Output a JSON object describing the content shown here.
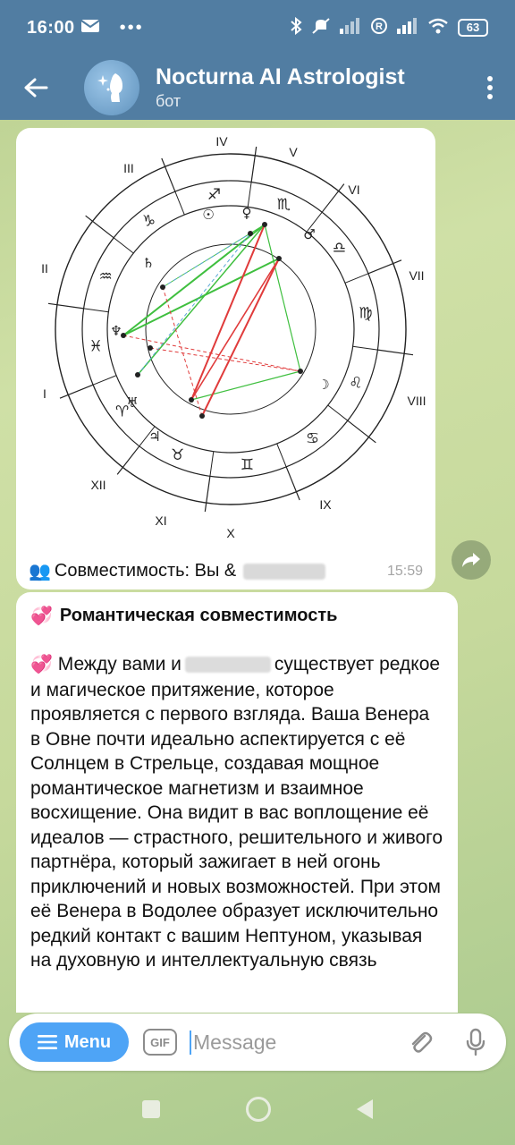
{
  "status_bar": {
    "time": "16:00",
    "battery": "63",
    "icons": [
      "mail-icon",
      "more-icon",
      "bluetooth-icon",
      "mute-icon",
      "signal-icon",
      "registered-icon",
      "signal-icon",
      "wifi-icon",
      "battery-icon"
    ]
  },
  "header": {
    "title": "Nocturna AI Astrologist",
    "subtitle": "бот"
  },
  "chart_message": {
    "house_numerals": [
      "I",
      "II",
      "III",
      "IV",
      "V",
      "VI",
      "VII",
      "VIII",
      "IX",
      "X",
      "XI",
      "XII"
    ],
    "caption_prefix": "👥",
    "caption": "Совместимость: Вы &",
    "timestamp": "15:59"
  },
  "text_message": {
    "heading_emoji": "💞",
    "heading": "Романтическая совместимость",
    "para_emoji": "💞",
    "para_start": "Между вами и",
    "para_rest": "существует редкое и магическое притяжение, которое проявляется с первого взгляда. Ваша Венера в Овне почти идеально аспектируется с её Солнцем в Стрельце, создавая мощное романтическое магнетизм и взаимное восхищение. Она видит в вас воплощение её идеалов — страстного, решительного и живого партнёра, который зажигает в ней огонь приключений и новых возможностей. При этом её Венера в Водолее образует исключительно редкий контакт с вашим Нептуном, указывая на духовную и интеллектуальную связь"
  },
  "input_bar": {
    "menu_label": "Menu",
    "gif_label": "GIF",
    "placeholder": "Message"
  },
  "colors": {
    "header": "#517da2",
    "menu_button": "#4ea4f6",
    "aspect_green": "#3fbf3f",
    "aspect_red": "#e03b3b",
    "aspect_blue": "#5aa6d6"
  }
}
